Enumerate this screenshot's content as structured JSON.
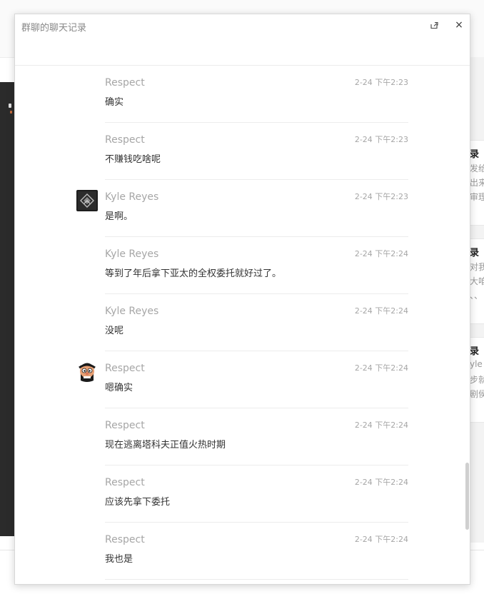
{
  "dialog": {
    "title": "群聊的聊天记录",
    "share_icon": "share-icon",
    "close_icon": "close-icon",
    "close_label": "×"
  },
  "messages": [
    {
      "sender": "Respect",
      "time": "2-24 下午2:23",
      "text": "确实",
      "avatar": ""
    },
    {
      "sender": "Respect",
      "time": "2-24 下午2:23",
      "text": "不赚钱吃啥呢",
      "avatar": ""
    },
    {
      "sender": "Kyle Reyes",
      "time": "2-24 下午2:23",
      "text": "是啊。",
      "avatar": "dark-logo-avatar"
    },
    {
      "sender": "Kyle Reyes",
      "time": "2-24 下午2:24",
      "text": "等到了年后拿下亚太的全权委托就好过了。",
      "avatar": ""
    },
    {
      "sender": "Kyle Reyes",
      "time": "2-24 下午2:24",
      "text": "没呢",
      "avatar": ""
    },
    {
      "sender": "Respect",
      "time": "2-24 下午2:24",
      "text": "嗯确实",
      "avatar": "cartoon-face-avatar"
    },
    {
      "sender": "Respect",
      "time": "2-24 下午2:24",
      "text": "现在逃离塔科夫正值火热时期",
      "avatar": ""
    },
    {
      "sender": "Respect",
      "time": "2-24 下午2:24",
      "text": "应该先拿下委托",
      "avatar": ""
    },
    {
      "sender": "Respect",
      "time": "2-24 下午2:24",
      "text": "我也是",
      "avatar": ""
    }
  ],
  "background": {
    "cards": [
      {
        "title": "录",
        "lines": [
          "发给",
          "出来",
          "审理"
        ]
      },
      {
        "title": "录",
        "lines": [
          "对我",
          "大咱",
          "、、"
        ]
      },
      {
        "title": "录",
        "lines": [
          "yle I",
          "步就",
          "剧侯"
        ]
      }
    ]
  },
  "scrollbar": {
    "position": 0.88,
    "visible_fraction": 0.13
  }
}
